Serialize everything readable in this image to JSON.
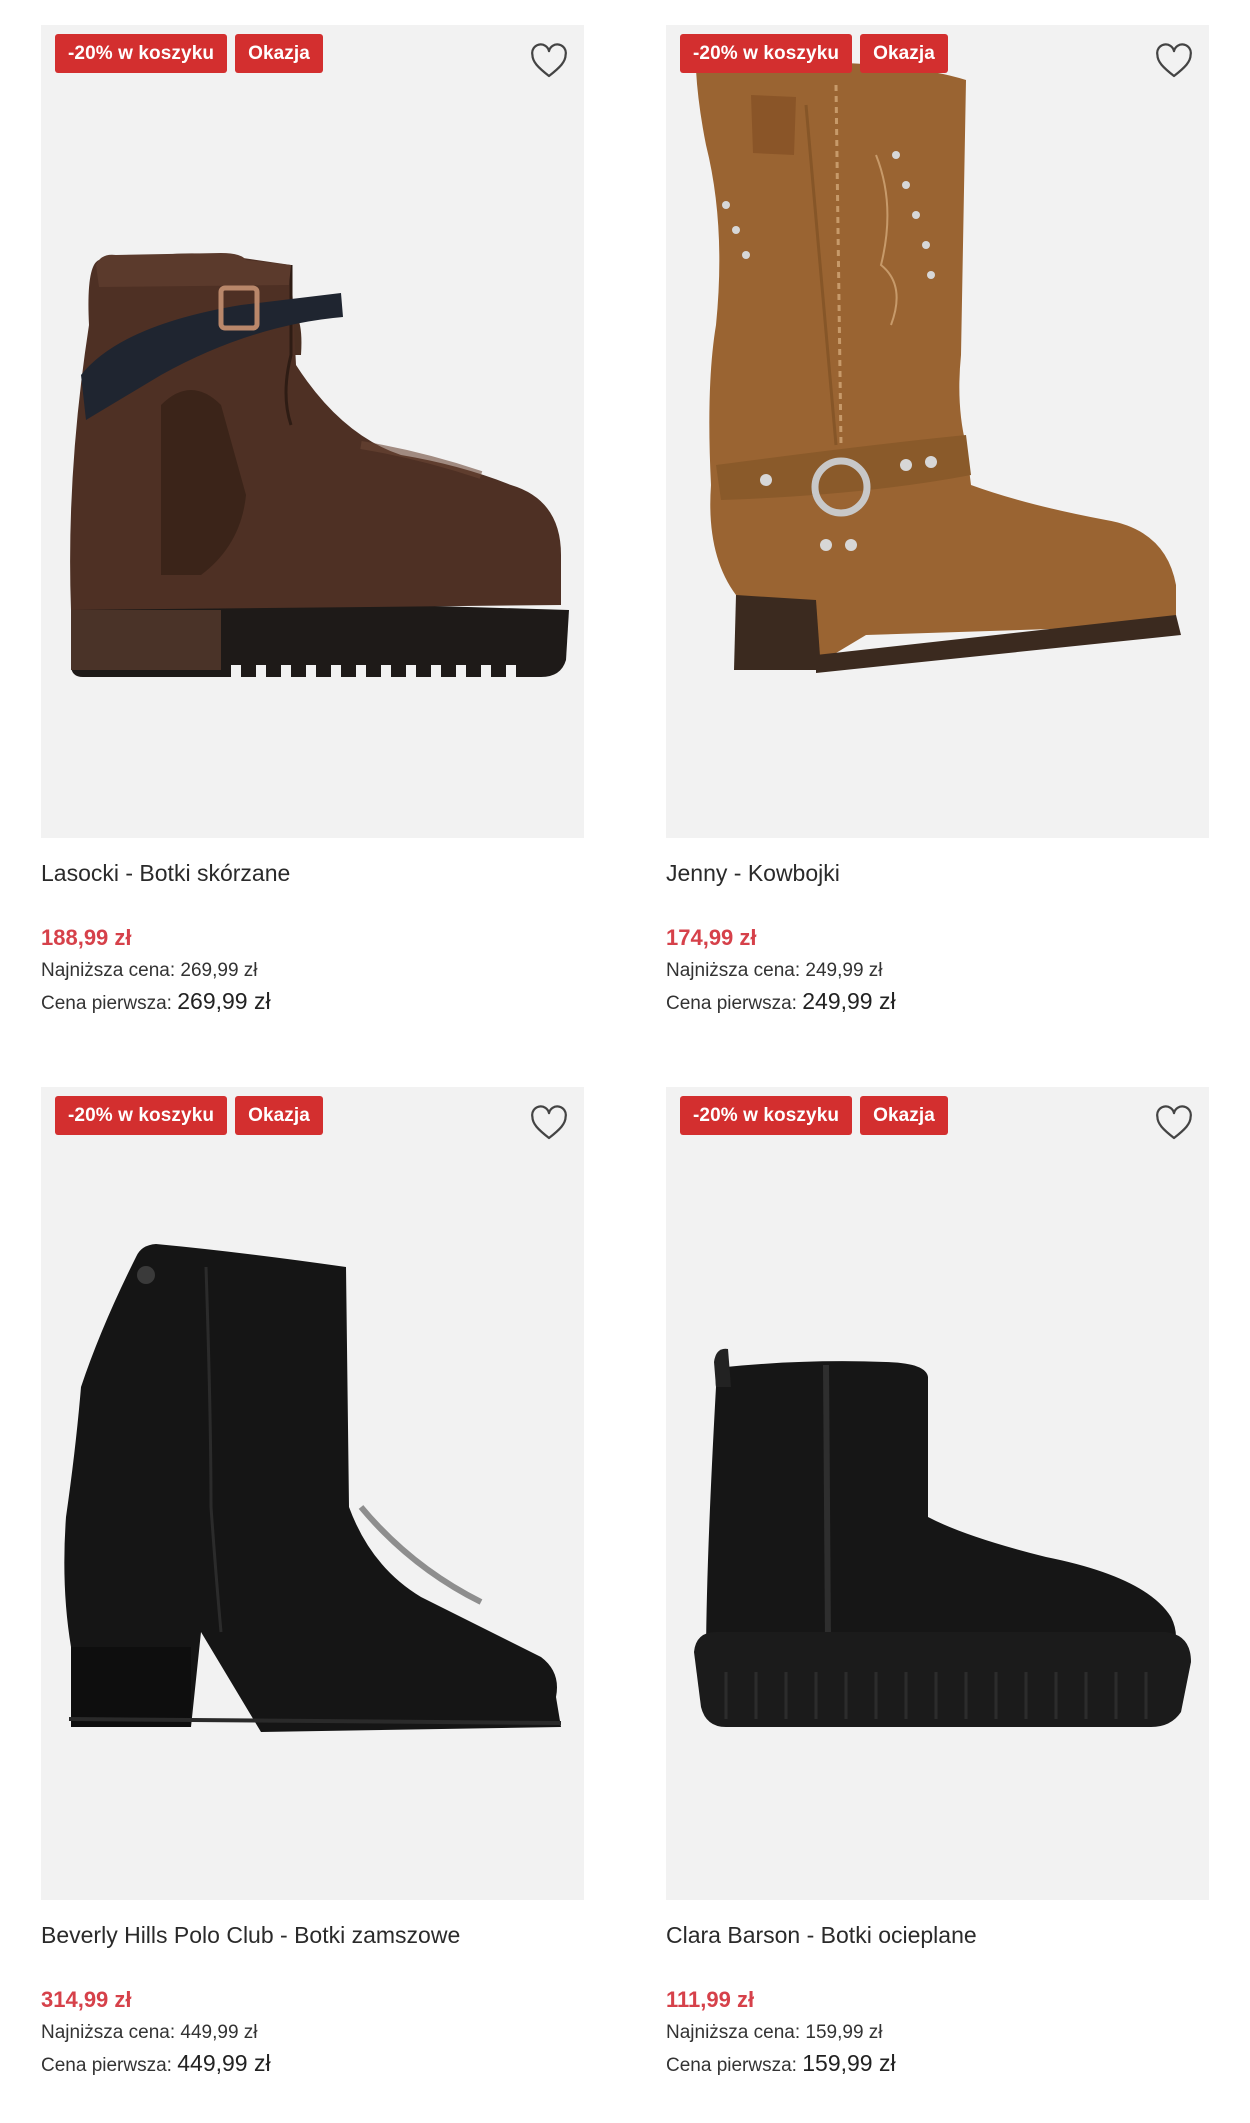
{
  "colors": {
    "badge_red": "#d32f2f",
    "price_red": "#d6414a",
    "image_bg": "#f2f2f2"
  },
  "products": [
    {
      "name": "Lasocki - Botki skórzane",
      "badges": [
        "-20% w koszyku",
        "Okazja"
      ],
      "price": "188,99 zł",
      "lowest_label": "Najniższa cena:",
      "lowest_value": "269,99 zł",
      "first_label": "Cena pierwsza:",
      "first_value": "269,99 zł",
      "image": "brown-leather-ankle-boot-with-strap",
      "icon": "heart-outline-icon"
    },
    {
      "name": "Jenny - Kowbojki",
      "badges": [
        "-20% w koszyku",
        "Okazja"
      ],
      "price": "174,99 zł",
      "lowest_label": "Najniższa cena:",
      "lowest_value": "249,99 zł",
      "first_label": "Cena pierwsza:",
      "first_value": "249,99 zł",
      "image": "tan-suede-studded-cowboy-boot",
      "icon": "heart-outline-icon"
    },
    {
      "name": "Beverly Hills Polo Club - Botki zamszowe",
      "badges": [
        "-20% w koszyku",
        "Okazja"
      ],
      "price": "314,99 zł",
      "lowest_label": "Najniższa cena:",
      "lowest_value": "449,99 zł",
      "first_label": "Cena pierwsza:",
      "first_value": "449,99 zł",
      "image": "black-suede-block-heel-ankle-boot",
      "icon": "heart-outline-icon"
    },
    {
      "name": "Clara Barson - Botki ocieplane",
      "badges": [
        "-20% w koszyku",
        "Okazja"
      ],
      "price": "111,99 zł",
      "lowest_label": "Najniższa cena:",
      "lowest_value": "159,99 zł",
      "first_label": "Cena pierwsza:",
      "first_value": "159,99 zł",
      "image": "black-insulated-platform-boot",
      "icon": "heart-outline-icon"
    }
  ]
}
